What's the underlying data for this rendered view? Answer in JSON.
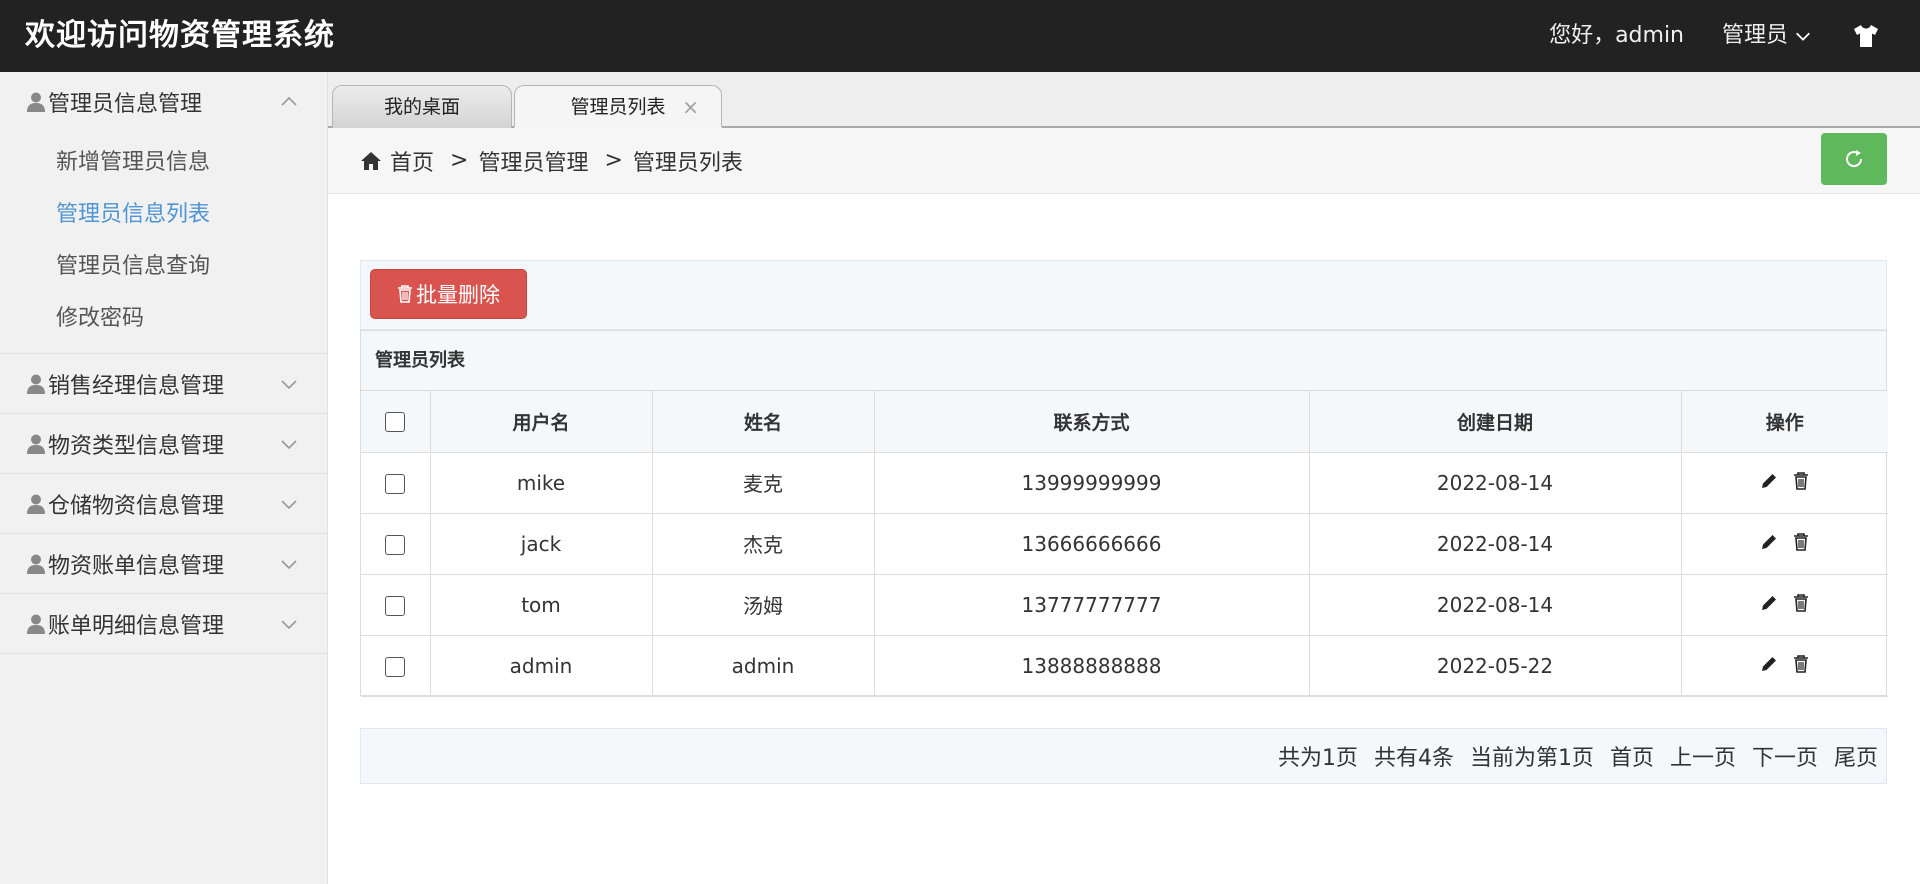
{
  "header": {
    "title": "欢迎访问物资管理系统",
    "greeting": "您好，admin",
    "role": "管理员"
  },
  "sidebar": {
    "groups": [
      {
        "label": "管理员信息管理",
        "expanded": true,
        "items": [
          {
            "label": "新增管理员信息",
            "active": false
          },
          {
            "label": "管理员信息列表",
            "active": true
          },
          {
            "label": "管理员信息查询",
            "active": false
          },
          {
            "label": "修改密码",
            "active": false
          }
        ]
      },
      {
        "label": "销售经理信息管理",
        "expanded": false
      },
      {
        "label": "物资类型信息管理",
        "expanded": false
      },
      {
        "label": "仓储物资信息管理",
        "expanded": false
      },
      {
        "label": "物资账单信息管理",
        "expanded": false
      },
      {
        "label": "账单明细信息管理",
        "expanded": false
      }
    ]
  },
  "tabs": [
    {
      "label": "我的桌面",
      "active": false
    },
    {
      "label": "管理员列表",
      "active": true,
      "close": "×"
    }
  ],
  "breadcrumb": {
    "home": "首页",
    "sep": ">",
    "level1": "管理员管理",
    "level2": "管理员列表"
  },
  "toolbar": {
    "batch_delete": "批量删除"
  },
  "table": {
    "title": "管理员列表",
    "columns": [
      "用户名",
      "姓名",
      "联系方式",
      "创建日期",
      "操作"
    ],
    "rows": [
      {
        "username": "mike",
        "name": "麦克",
        "phone": "13999999999",
        "created": "2022-08-14"
      },
      {
        "username": "jack",
        "name": "杰克",
        "phone": "13666666666",
        "created": "2022-08-14"
      },
      {
        "username": "tom",
        "name": "汤姆",
        "phone": "13777777777",
        "created": "2022-08-14"
      },
      {
        "username": "admin",
        "name": "admin",
        "phone": "13888888888",
        "created": "2022-05-22"
      }
    ]
  },
  "pager": {
    "total_pages": "共为1页",
    "total_items": "共有4条",
    "current": "当前为第1页",
    "first": "首页",
    "prev": "上一页",
    "next": "下一页",
    "last": "尾页"
  },
  "colors": {
    "header_bg": "#222222",
    "active_link": "#4f94d4",
    "danger": "#d9534f",
    "success": "#5fb85c"
  }
}
